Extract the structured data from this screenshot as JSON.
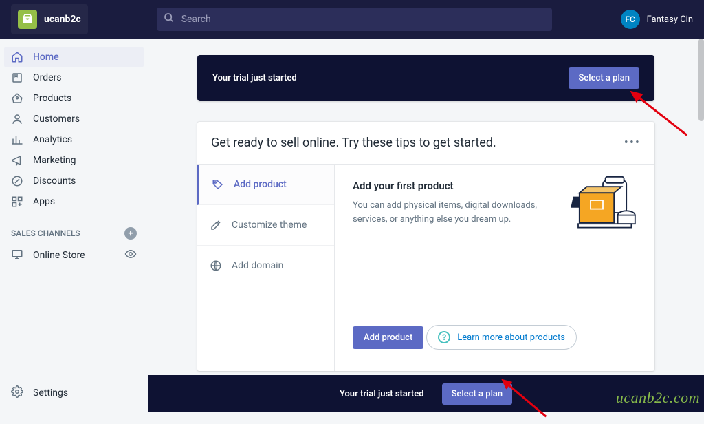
{
  "store": {
    "name": "ucanb2c"
  },
  "search": {
    "placeholder": "Search"
  },
  "user": {
    "initials": "FC",
    "name": "Fantasy Cin"
  },
  "nav": {
    "home": "Home",
    "orders": "Orders",
    "products": "Products",
    "customers": "Customers",
    "analytics": "Analytics",
    "marketing": "Marketing",
    "discounts": "Discounts",
    "apps": "Apps"
  },
  "salesChannels": {
    "title": "SALES CHANNELS",
    "onlineStore": "Online Store"
  },
  "settings": "Settings",
  "trial": {
    "text": "Your trial just started",
    "button": "Select a plan"
  },
  "card": {
    "title": "Get ready to sell online. Try these tips to get started.",
    "steps": {
      "addProduct": "Add product",
      "customizeTheme": "Customize theme",
      "addDomain": "Add domain"
    },
    "content": {
      "heading": "Add your first product",
      "desc": "You can add physical items, digital downloads, services, or anything else you dream up.",
      "button": "Add product",
      "learnMore": "Learn more about products"
    }
  },
  "bottomBar": {
    "text": "Your trial just started",
    "button": "Select a plan"
  },
  "watermark": "ucanb2c.com"
}
